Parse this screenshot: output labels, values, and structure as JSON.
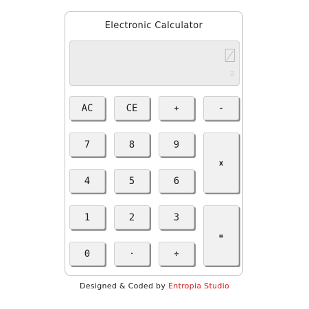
{
  "app": {
    "title": "Electronic Calculator"
  },
  "display": {
    "main": "⍁",
    "sub": "⍁"
  },
  "keys": {
    "ac": "AC",
    "ce": "CE",
    "plus": "+",
    "minus": "-",
    "seven": "7",
    "eight": "8",
    "nine": "9",
    "multiply": "x",
    "four": "4",
    "five": "5",
    "six": "6",
    "one": "1",
    "two": "2",
    "three": "3",
    "equals": "=",
    "zero": "0",
    "dot": "·",
    "divide": "÷"
  },
  "footer": {
    "prefix": "Designed & Coded by ",
    "studio": "Entropia Studio"
  },
  "colors": {
    "brand_red": "#d11a1a",
    "key_bg": "#f1f1f1",
    "display_bg": "#ececec"
  }
}
